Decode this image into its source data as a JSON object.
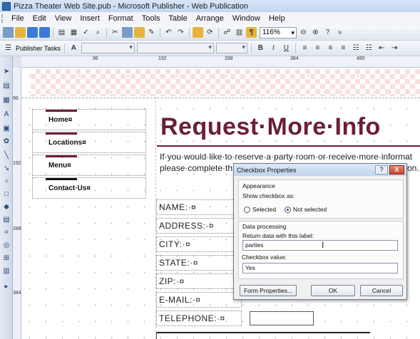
{
  "window": {
    "title": "Pizza Theater Web Site.pub - Microsoft Publisher - Web Publication"
  },
  "menu": [
    "File",
    "Edit",
    "View",
    "Insert",
    "Format",
    "Tools",
    "Table",
    "Arrange",
    "Window",
    "Help"
  ],
  "toolbar": {
    "zoom": "116%"
  },
  "formatting_toolbar": {
    "publisher_tasks": "Publisher Tasks"
  },
  "rulers": {
    "h_labels": [
      "96",
      "192",
      "288",
      "384",
      "480"
    ],
    "v_labels": [
      "96",
      "192",
      "288",
      "384"
    ]
  },
  "nav": [
    "Home¤",
    "Locations¤",
    "Menu¤",
    "Contact·Us¤"
  ],
  "page": {
    "headline": "Request·More·Info",
    "body_line1": "If·you·would·like·to·reserve·a·party·room·or·receive·more·informat",
    "body_line2": "please·complete·th",
    "body_tail": "on."
  },
  "form_labels": [
    "NAME:·¤",
    "ADDRESS:·¤",
    "CITY:·¤",
    "STATE:·¤",
    "ZIP:·¤",
    "E-MAIL:·¤",
    "TELEPHONE:·¤"
  ],
  "dialog": {
    "title": "Checkbox Properties",
    "help": "?",
    "close": "X",
    "appearance_heading": "Appearance",
    "show_as_label": "Show checkbox as:",
    "option_selected": "Selected",
    "option_not_selected": "Not selected",
    "selected_option": "Not selected",
    "data_heading": "Data processing",
    "return_label": "Return data with this label:",
    "return_value": "parties",
    "checkbox_value_label": "Checkbox value:",
    "checkbox_value": "Yes",
    "form_properties_button": "Form Properties...",
    "ok_button": "OK",
    "cancel_button": "Cancel"
  }
}
